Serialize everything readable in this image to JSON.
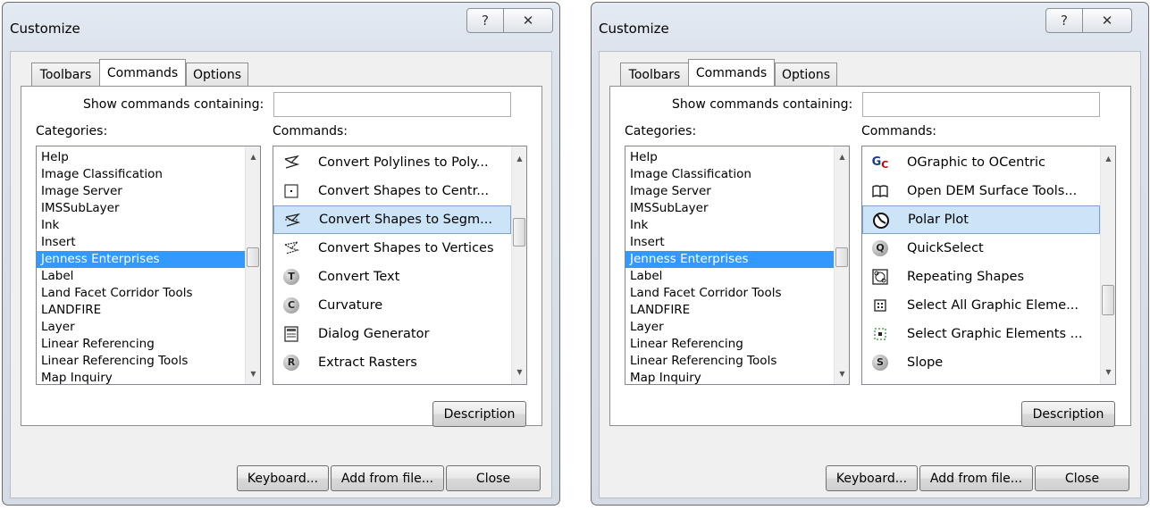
{
  "left": {
    "title": "Customize",
    "help_glyph": "?",
    "close_glyph": "✕",
    "tabs": [
      "Toolbars",
      "Commands",
      "Options"
    ],
    "active_tab": "Commands",
    "search_label": "Show commands containing:",
    "search_value": "",
    "categories_label": "Categories:",
    "commands_label": "Commands:",
    "categories": [
      "Help",
      "Image Classification",
      "Image Server",
      "IMSSubLayer",
      "Ink",
      "Insert",
      "Jenness Enterprises",
      "Label",
      "Land Facet Corridor Tools",
      "LANDFIRE",
      "Layer",
      "Linear Referencing",
      "Linear Referencing Tools",
      "Map Inquiry"
    ],
    "selected_category": "Jenness Enterprises",
    "commands": [
      {
        "label": "Convert Polylines to Poly...",
        "icon": "polyline-to-polygon-icon"
      },
      {
        "label": "Convert Shapes to Centr...",
        "icon": "centroid-icon"
      },
      {
        "label": "Convert Shapes to Segm...",
        "icon": "segments-icon"
      },
      {
        "label": "Convert Shapes to Vertices",
        "icon": "vertices-icon"
      },
      {
        "label": "Convert Text",
        "icon": "t-badge-icon",
        "glyph": "T"
      },
      {
        "label": "Curvature",
        "icon": "c-badge-icon",
        "glyph": "C"
      },
      {
        "label": "Dialog Generator",
        "icon": "dialog-generator-icon"
      },
      {
        "label": "Extract Rasters",
        "icon": "r-badge-icon",
        "glyph": "R"
      }
    ],
    "selected_command": "Convert Shapes to Segm...",
    "description_button": "Description",
    "keyboard_button": "Keyboard...",
    "add_from_file_button": "Add from file...",
    "close_button": "Close"
  },
  "right": {
    "title": "Customize",
    "help_glyph": "?",
    "close_glyph": "✕",
    "tabs": [
      "Toolbars",
      "Commands",
      "Options"
    ],
    "active_tab": "Commands",
    "search_label": "Show commands containing:",
    "search_value": "",
    "categories_label": "Categories:",
    "commands_label": "Commands:",
    "categories": [
      "Help",
      "Image Classification",
      "Image Server",
      "IMSSubLayer",
      "Ink",
      "Insert",
      "Jenness Enterprises",
      "Label",
      "Land Facet Corridor Tools",
      "LANDFIRE",
      "Layer",
      "Linear Referencing",
      "Linear Referencing Tools",
      "Map Inquiry"
    ],
    "selected_category": "Jenness Enterprises",
    "commands": [
      {
        "label": "OGraphic to OCentric",
        "icon": "gc-icon",
        "glyph": "G",
        "glyph2": "C"
      },
      {
        "label": "Open DEM Surface Tools...",
        "icon": "book-icon"
      },
      {
        "label": "Polar Plot",
        "icon": "polar-plot-icon"
      },
      {
        "label": "QuickSelect",
        "icon": "q-badge-icon",
        "glyph": "Q"
      },
      {
        "label": "Repeating Shapes",
        "icon": "repeating-shapes-icon"
      },
      {
        "label": "Select All Graphic Eleme...",
        "icon": "select-all-icon"
      },
      {
        "label": "Select Graphic Elements ...",
        "icon": "select-graphic-icon"
      },
      {
        "label": "Slope",
        "icon": "s-badge-icon",
        "glyph": "S"
      }
    ],
    "selected_command": "Polar Plot",
    "description_button": "Description",
    "keyboard_button": "Keyboard...",
    "add_from_file_button": "Add from file...",
    "close_button": "Close"
  }
}
